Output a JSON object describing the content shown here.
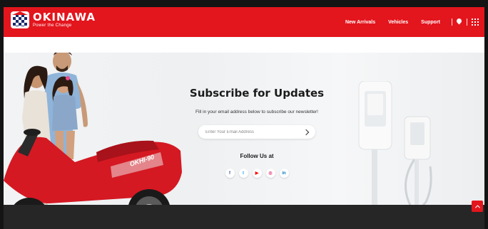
{
  "header": {
    "brand": "OKINAWA",
    "tagline": "Power the Change",
    "nav": [
      "New Arrivals",
      "Vehicles",
      "Support"
    ],
    "icons": [
      "location-pin-icon",
      "apps-grid-icon"
    ]
  },
  "subscribe": {
    "title": "Subscribe for Updates",
    "subtitle": "Fill in your email address below to subscribe our newsletter!",
    "email_placeholder": "Enter Your Email Address",
    "follow_label": "Follow Us at",
    "socials": [
      {
        "name": "facebook",
        "glyph": "f",
        "color": "#3b5998"
      },
      {
        "name": "twitter",
        "glyph": "t",
        "color": "#1da1f2"
      },
      {
        "name": "youtube",
        "glyph": "▶",
        "color": "#ff0000"
      },
      {
        "name": "instagram",
        "glyph": "◎",
        "color": "#e1306c"
      },
      {
        "name": "linkedin",
        "glyph": "in",
        "color": "#0077b5"
      }
    ]
  },
  "scooter_model_text": "OKHI-90",
  "colors": {
    "brand_red": "#e3151d",
    "footer": "#262626",
    "hero_bg": "#f2f3f4"
  }
}
